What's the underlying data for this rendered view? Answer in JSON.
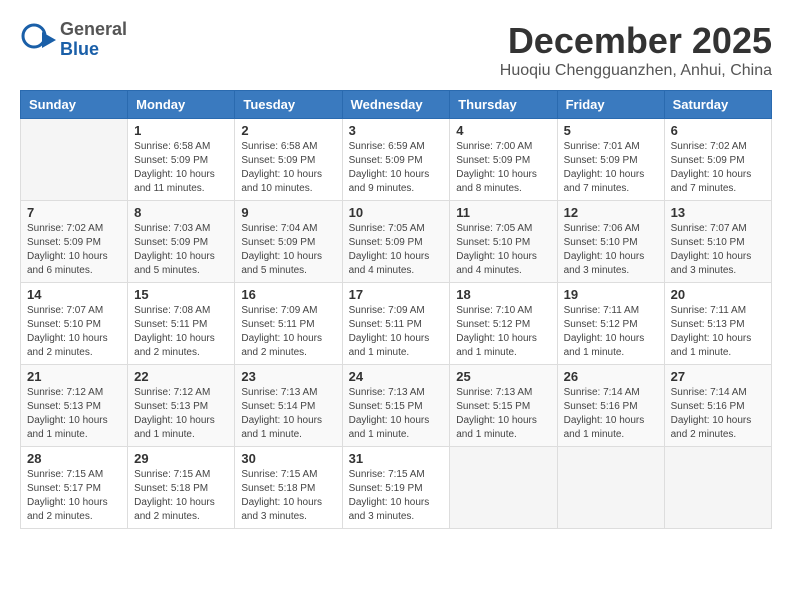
{
  "logo": {
    "general": "General",
    "blue": "Blue"
  },
  "title": "December 2025",
  "location": "Huoqiu Chengguanzhen, Anhui, China",
  "weekdays": [
    "Sunday",
    "Monday",
    "Tuesday",
    "Wednesday",
    "Thursday",
    "Friday",
    "Saturday"
  ],
  "weeks": [
    [
      {
        "day": "",
        "info": ""
      },
      {
        "day": "1",
        "info": "Sunrise: 6:58 AM\nSunset: 5:09 PM\nDaylight: 10 hours and 11 minutes."
      },
      {
        "day": "2",
        "info": "Sunrise: 6:58 AM\nSunset: 5:09 PM\nDaylight: 10 hours and 10 minutes."
      },
      {
        "day": "3",
        "info": "Sunrise: 6:59 AM\nSunset: 5:09 PM\nDaylight: 10 hours and 9 minutes."
      },
      {
        "day": "4",
        "info": "Sunrise: 7:00 AM\nSunset: 5:09 PM\nDaylight: 10 hours and 8 minutes."
      },
      {
        "day": "5",
        "info": "Sunrise: 7:01 AM\nSunset: 5:09 PM\nDaylight: 10 hours and 7 minutes."
      },
      {
        "day": "6",
        "info": "Sunrise: 7:02 AM\nSunset: 5:09 PM\nDaylight: 10 hours and 7 minutes."
      }
    ],
    [
      {
        "day": "7",
        "info": "Sunrise: 7:02 AM\nSunset: 5:09 PM\nDaylight: 10 hours and 6 minutes."
      },
      {
        "day": "8",
        "info": "Sunrise: 7:03 AM\nSunset: 5:09 PM\nDaylight: 10 hours and 5 minutes."
      },
      {
        "day": "9",
        "info": "Sunrise: 7:04 AM\nSunset: 5:09 PM\nDaylight: 10 hours and 5 minutes."
      },
      {
        "day": "10",
        "info": "Sunrise: 7:05 AM\nSunset: 5:09 PM\nDaylight: 10 hours and 4 minutes."
      },
      {
        "day": "11",
        "info": "Sunrise: 7:05 AM\nSunset: 5:10 PM\nDaylight: 10 hours and 4 minutes."
      },
      {
        "day": "12",
        "info": "Sunrise: 7:06 AM\nSunset: 5:10 PM\nDaylight: 10 hours and 3 minutes."
      },
      {
        "day": "13",
        "info": "Sunrise: 7:07 AM\nSunset: 5:10 PM\nDaylight: 10 hours and 3 minutes."
      }
    ],
    [
      {
        "day": "14",
        "info": "Sunrise: 7:07 AM\nSunset: 5:10 PM\nDaylight: 10 hours and 2 minutes."
      },
      {
        "day": "15",
        "info": "Sunrise: 7:08 AM\nSunset: 5:11 PM\nDaylight: 10 hours and 2 minutes."
      },
      {
        "day": "16",
        "info": "Sunrise: 7:09 AM\nSunset: 5:11 PM\nDaylight: 10 hours and 2 minutes."
      },
      {
        "day": "17",
        "info": "Sunrise: 7:09 AM\nSunset: 5:11 PM\nDaylight: 10 hours and 1 minute."
      },
      {
        "day": "18",
        "info": "Sunrise: 7:10 AM\nSunset: 5:12 PM\nDaylight: 10 hours and 1 minute."
      },
      {
        "day": "19",
        "info": "Sunrise: 7:11 AM\nSunset: 5:12 PM\nDaylight: 10 hours and 1 minute."
      },
      {
        "day": "20",
        "info": "Sunrise: 7:11 AM\nSunset: 5:13 PM\nDaylight: 10 hours and 1 minute."
      }
    ],
    [
      {
        "day": "21",
        "info": "Sunrise: 7:12 AM\nSunset: 5:13 PM\nDaylight: 10 hours and 1 minute."
      },
      {
        "day": "22",
        "info": "Sunrise: 7:12 AM\nSunset: 5:13 PM\nDaylight: 10 hours and 1 minute."
      },
      {
        "day": "23",
        "info": "Sunrise: 7:13 AM\nSunset: 5:14 PM\nDaylight: 10 hours and 1 minute."
      },
      {
        "day": "24",
        "info": "Sunrise: 7:13 AM\nSunset: 5:15 PM\nDaylight: 10 hours and 1 minute."
      },
      {
        "day": "25",
        "info": "Sunrise: 7:13 AM\nSunset: 5:15 PM\nDaylight: 10 hours and 1 minute."
      },
      {
        "day": "26",
        "info": "Sunrise: 7:14 AM\nSunset: 5:16 PM\nDaylight: 10 hours and 1 minute."
      },
      {
        "day": "27",
        "info": "Sunrise: 7:14 AM\nSunset: 5:16 PM\nDaylight: 10 hours and 2 minutes."
      }
    ],
    [
      {
        "day": "28",
        "info": "Sunrise: 7:15 AM\nSunset: 5:17 PM\nDaylight: 10 hours and 2 minutes."
      },
      {
        "day": "29",
        "info": "Sunrise: 7:15 AM\nSunset: 5:18 PM\nDaylight: 10 hours and 2 minutes."
      },
      {
        "day": "30",
        "info": "Sunrise: 7:15 AM\nSunset: 5:18 PM\nDaylight: 10 hours and 3 minutes."
      },
      {
        "day": "31",
        "info": "Sunrise: 7:15 AM\nSunset: 5:19 PM\nDaylight: 10 hours and 3 minutes."
      },
      {
        "day": "",
        "info": ""
      },
      {
        "day": "",
        "info": ""
      },
      {
        "day": "",
        "info": ""
      }
    ]
  ]
}
